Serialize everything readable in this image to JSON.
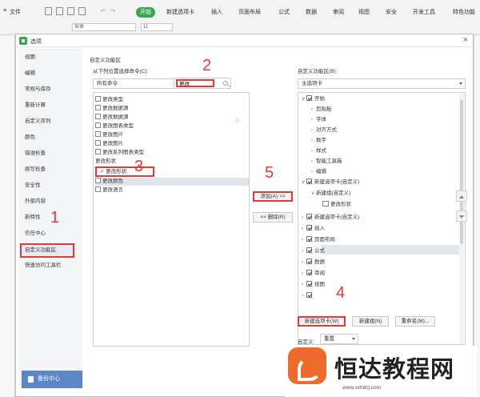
{
  "ribbon": {
    "file_menu": "文件",
    "tabs": [
      "开始",
      "新建选项卡",
      "插入",
      "页面布局",
      "公式",
      "数据",
      "审阅",
      "视图",
      "安全",
      "开发工具",
      "特色功能"
    ],
    "font_name": "宋体",
    "font_size": "11"
  },
  "dialog": {
    "title": "选项",
    "close_icon": "close-icon"
  },
  "nav": {
    "items": [
      "视图",
      "编辑",
      "常规与保存",
      "重新计算",
      "自定义序列",
      "颜色",
      "错误检查",
      "拼写检查",
      "安全性",
      "外部内容",
      "新特性",
      "信任中心",
      "自定义功能区",
      "快速访问工具栏"
    ],
    "active": "自定义功能区",
    "help_button": "备份中心"
  },
  "left_panel": {
    "section_title": "自定义功能区",
    "choose_label": "从下列位置选择命令(C):",
    "source_select": "所有命令",
    "search_value": "更改",
    "commands": [
      "更改类型",
      "更改数据源",
      "更改数据源",
      "更改图表类型",
      "更改图片",
      "更改图片",
      "更改系列图表类型",
      "更改形状",
      "更改形状",
      "更改颜色",
      "更改语言"
    ],
    "selected_command": "更改形状"
  },
  "middle": {
    "add_button": "添加(A) >>",
    "remove_button": "<< 删除(R)"
  },
  "right_panel": {
    "section_title": "自定义功能区(B):",
    "tab_select": "主选项卡",
    "tree": [
      {
        "label": "开始",
        "checked": true,
        "expanded": true,
        "level": 0
      },
      {
        "label": "剪贴板",
        "level": 1
      },
      {
        "label": "字体",
        "level": 1
      },
      {
        "label": "对齐方式",
        "level": 1
      },
      {
        "label": "数字",
        "level": 1
      },
      {
        "label": "样式",
        "level": 1
      },
      {
        "label": "智能工具箱",
        "level": 1
      },
      {
        "label": "编辑",
        "level": 1
      },
      {
        "label": "新建选项卡(自定义)",
        "checked": true,
        "expanded": true,
        "level": 0
      },
      {
        "label": "新建组(自定义)",
        "expanded": true,
        "level": 1
      },
      {
        "label": "更改形状",
        "level": 2,
        "highlight": true
      },
      {
        "label": "新建选项卡(自定义)",
        "checked": true,
        "level": 0
      },
      {
        "label": "插入",
        "checked": true,
        "level": 0
      },
      {
        "label": "页面布局",
        "checked": true,
        "level": 0
      },
      {
        "label": "公式",
        "checked": true,
        "level": 0
      },
      {
        "label": "数据",
        "checked": true,
        "level": 0
      },
      {
        "label": "审阅",
        "checked": true,
        "level": 0
      },
      {
        "label": "视图",
        "checked": true,
        "level": 0
      },
      {
        "label": "",
        "checked": true,
        "level": 0
      }
    ],
    "new_tab_button": "新建选项卡(W)",
    "new_group_button": "新建组(N)",
    "rename_button": "重命名(M)...",
    "customize_label": "自定义:",
    "reset_select": "重置"
  },
  "steps": [
    "1",
    "2",
    "3",
    "4",
    "5"
  ],
  "watermark": {
    "brand": "恒达教程网",
    "url": "www.sxhdcj.com"
  }
}
